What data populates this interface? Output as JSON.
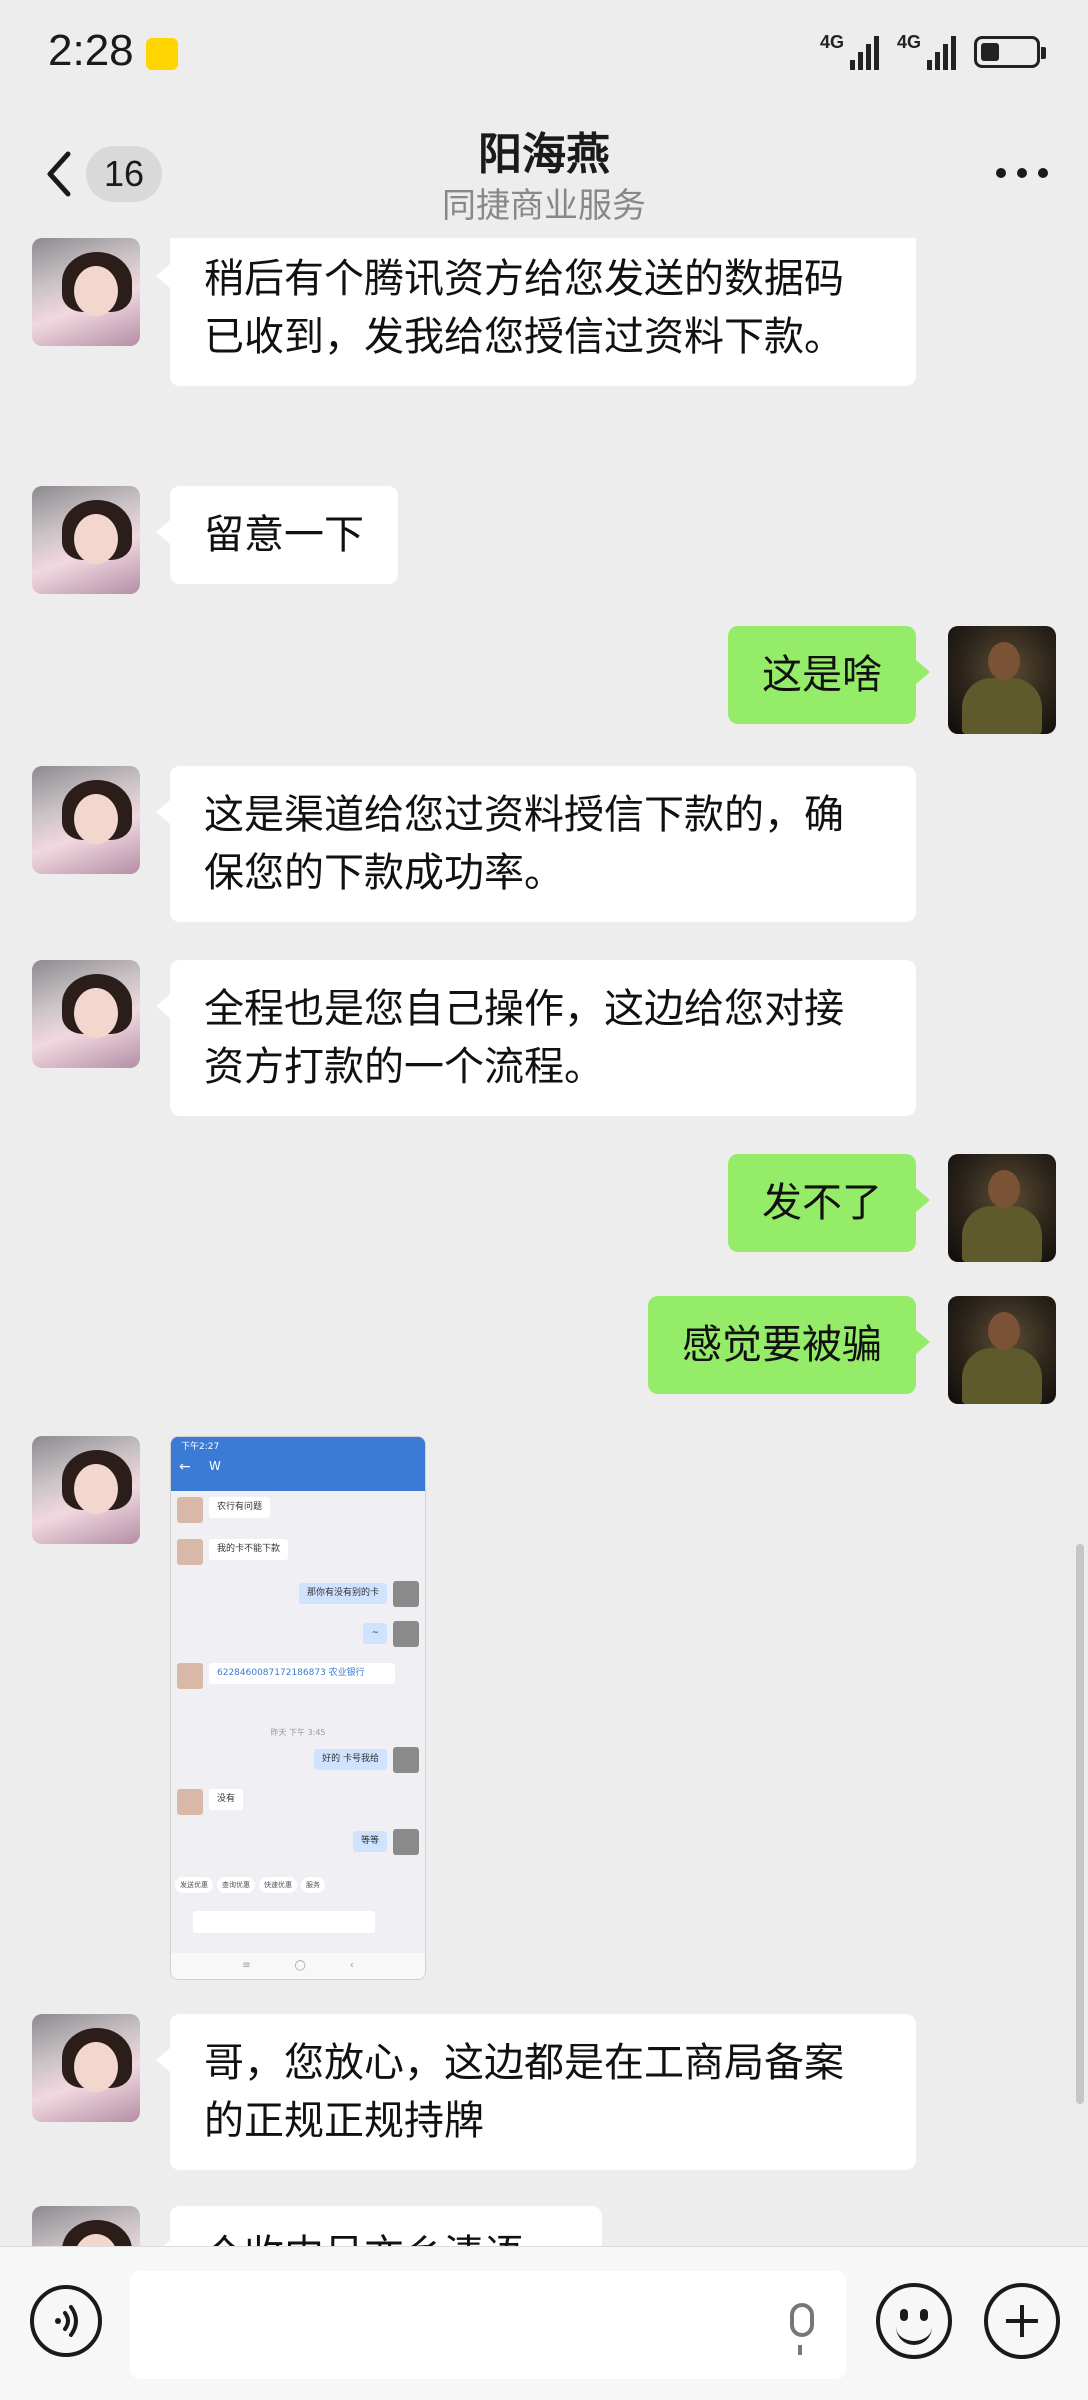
{
  "status_bar": {
    "time": "2:28",
    "network_1": "4G",
    "network_2": "4G"
  },
  "header": {
    "unread_count": "16",
    "title": "阳海燕",
    "subtitle": "同捷商业服务"
  },
  "messages": [
    {
      "from": "other",
      "text": "稍后有个腾讯资方给您发送的数据码已收到，发我给您授信过资料下款。"
    },
    {
      "from": "other",
      "text": "留意一下"
    },
    {
      "from": "self",
      "text": "这是啥"
    },
    {
      "from": "other",
      "text": "这是渠道给您过资料授信下款的，确保您的下款成功率。"
    },
    {
      "from": "other",
      "text": "全程也是您自己操作，这边给您对接资方打款的一个流程。"
    },
    {
      "from": "self",
      "text": "发不了"
    },
    {
      "from": "self",
      "text": "感觉要被骗"
    },
    {
      "from": "other",
      "type": "image"
    },
    {
      "from": "other",
      "text": "哥，您放心，这边都是在工商局备案的正规正规持牌"
    },
    {
      "from": "other",
      "text": "个收内呈亦乡清语"
    }
  ],
  "embedded_screenshot": {
    "time": "下午2:27",
    "contact": "W",
    "lines": [
      "农行有问题",
      "我的卡不能下款",
      "那你有没有别的卡",
      "~",
      "6228460087172186873 农业银行",
      "好的 卡号我给",
      "没有",
      "等等"
    ],
    "divider_time": "昨天 下午 3:45",
    "chips": [
      "发送优惠",
      "查询优惠",
      "快速优惠",
      "服务"
    ]
  }
}
